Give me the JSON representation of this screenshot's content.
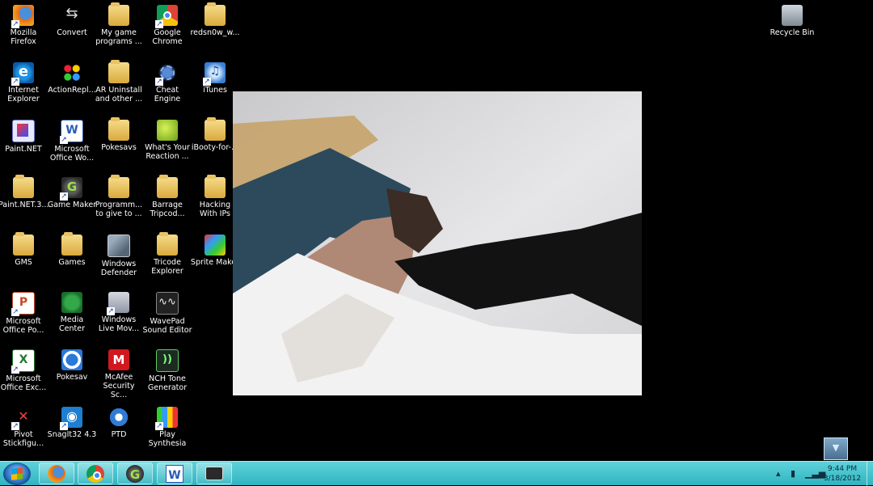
{
  "desktop": {
    "icons": [
      {
        "label": "Mozilla\nFirefox",
        "icon": "firefox-icon"
      },
      {
        "label": "Convert",
        "icon": "convert-icon"
      },
      {
        "label": "My game\nprograms ...",
        "icon": "folder-icon"
      },
      {
        "label": "Google\nChrome",
        "icon": "chrome-icon"
      },
      {
        "label": "redsn0w_w...",
        "icon": "folder-icon"
      },
      {
        "label": "Internet\nExplorer",
        "icon": "internet-explorer-icon"
      },
      {
        "label": "ActionRepl...",
        "icon": "action-replay-icon"
      },
      {
        "label": "AR Uninstall\nand other ...",
        "icon": "folder-icon"
      },
      {
        "label": "Cheat Engine",
        "icon": "cheat-engine-icon"
      },
      {
        "label": "iTunes",
        "icon": "itunes-icon"
      },
      {
        "label": "Paint.NET",
        "icon": "paint-net-icon"
      },
      {
        "label": "Microsoft\nOffice Wo...",
        "icon": "word-icon"
      },
      {
        "label": "Pokesavs",
        "icon": "folder-icon"
      },
      {
        "label": "What's Your\nReaction ...",
        "icon": "tennis-ball-icon"
      },
      {
        "label": "iBooty-for-...",
        "icon": "folder-icon"
      },
      {
        "label": "Paint.NET.3...",
        "icon": "folder-icon"
      },
      {
        "label": "Game Maker",
        "icon": "game-maker-icon"
      },
      {
        "label": "Programm...\nto give to ...",
        "icon": "folder-icon"
      },
      {
        "label": "Barrage\nTripcod...",
        "icon": "folder-icon"
      },
      {
        "label": "Hacking\nWith IPs",
        "icon": "folder-icon"
      },
      {
        "label": "GMS",
        "icon": "folder-icon"
      },
      {
        "label": "Games",
        "icon": "folder-icon"
      },
      {
        "label": "Windows\nDefender",
        "icon": "windows-defender-icon"
      },
      {
        "label": "Tricode\nExplorer",
        "icon": "folder-icon"
      },
      {
        "label": "Sprite Maker",
        "icon": "sprite-maker-icon"
      },
      {
        "label": "Microsoft\nOffice Po...",
        "icon": "powerpoint-icon"
      },
      {
        "label": "Media Center",
        "icon": "media-center-icon"
      },
      {
        "label": "Windows\nLive Mov...",
        "icon": "movie-maker-icon"
      },
      {
        "label": "WavePad\nSound Editor",
        "icon": "wavepad-icon"
      },
      {
        "label": "Microsoft\nOffice Exc...",
        "icon": "excel-icon"
      },
      {
        "label": "Pokesav",
        "icon": "pokesav-icon"
      },
      {
        "label": "McAfee\nSecurity Sc...",
        "icon": "mcafee-icon"
      },
      {
        "label": "NCH Tone\nGenerator",
        "icon": "nch-tone-icon"
      },
      {
        "label": "Pivot\nStickfigu...",
        "icon": "pivot-icon"
      },
      {
        "label": "SnagIt32 4.3",
        "icon": "snagit-icon"
      },
      {
        "label": "PTD",
        "icon": "ptd-icon"
      },
      {
        "label": "Play\nSynthesia",
        "icon": "synthesia-icon"
      }
    ],
    "recycle_bin": {
      "label": "Recycle Bin",
      "icon": "recycle-bin-icon"
    }
  },
  "taskbar": {
    "pinned": [
      "firefox-icon",
      "chrome-icon",
      "game-maker-icon",
      "word-icon",
      "camera-icon"
    ],
    "tray": {
      "time": "9:44 PM",
      "date": "3/18/2012"
    }
  }
}
